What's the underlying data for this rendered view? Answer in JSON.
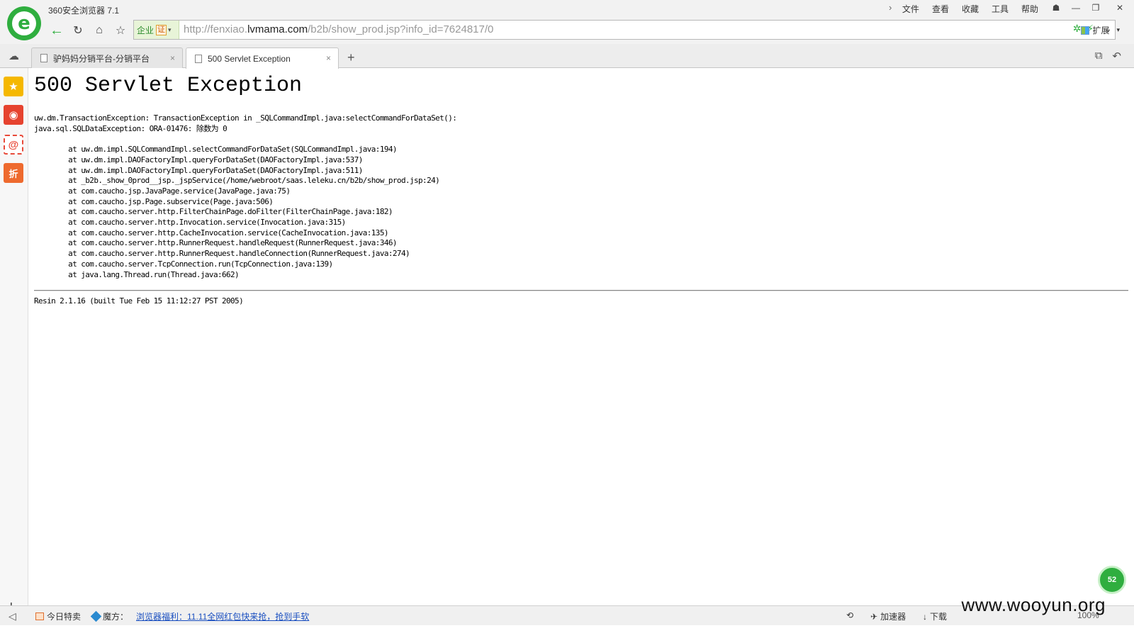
{
  "window": {
    "app_title": "360安全浏览器 7.1",
    "menu": [
      "文件",
      "查看",
      "收藏",
      "工具",
      "帮助"
    ],
    "menu_arrow": "›",
    "controls": [
      "☗",
      "—",
      "❐",
      "✕"
    ]
  },
  "navbar": {
    "back": "←",
    "reload": "↻",
    "home": "⌂",
    "favorite": "☆",
    "cert_label": "企业",
    "cert_badge": "证",
    "cert_arrow": "▾",
    "url_prefix": "http://fenxiao.",
    "url_host": "lvmama.com",
    "url_path": "/b2b/show_prod.jsp?info_id=7624817/0",
    "addr_icon_1": "✲",
    "addr_icon_2": "⚡",
    "dropdown": "⌄",
    "extend_label": "扩展",
    "extend_arrow": "▾"
  },
  "tabs": [
    {
      "title": "驴妈妈分销平台-分销平台",
      "active": false
    },
    {
      "title": "500 Servlet Exception",
      "active": true
    }
  ],
  "tab_close": "×",
  "new_tab": "+",
  "cloud_glyph": "☁",
  "tabbar_right": [
    "⧉",
    "↶"
  ],
  "sidebar": {
    "icons": [
      {
        "name": "favorites-star-icon",
        "glyph": "★",
        "bg": "#f5b800"
      },
      {
        "name": "weibo-icon",
        "glyph": "◉",
        "bg": "#e6432f"
      },
      {
        "name": "mail-icon",
        "glyph": "@",
        "bg": "#e84a3a"
      },
      {
        "name": "discount-icon",
        "glyph": "折",
        "bg": "#ee6a2e"
      }
    ],
    "plus": "+"
  },
  "page": {
    "heading": "500 Servlet Exception",
    "trace": "uw.dm.TransactionException: TransactionException in _SQLCommandImpl.java:selectCommandForDataSet():\njava.sql.SQLDataException: ORA-01476: 除数为 0\n\n        at uw.dm.impl.SQLCommandImpl.selectCommandForDataSet(SQLCommandImpl.java:194)\n        at uw.dm.impl.DAOFactoryImpl.queryForDataSet(DAOFactoryImpl.java:537)\n        at uw.dm.impl.DAOFactoryImpl.queryForDataSet(DAOFactoryImpl.java:511)\n        at _b2b._show_0prod__jsp._jspService(/home/webroot/saas.leleku.cn/b2b/show_prod.jsp:24)\n        at com.caucho.jsp.JavaPage.service(JavaPage.java:75)\n        at com.caucho.jsp.Page.subservice(Page.java:506)\n        at com.caucho.server.http.FilterChainPage.doFilter(FilterChainPage.java:182)\n        at com.caucho.server.http.Invocation.service(Invocation.java:315)\n        at com.caucho.server.http.CacheInvocation.service(CacheInvocation.java:135)\n        at com.caucho.server.http.RunnerRequest.handleRequest(RunnerRequest.java:346)\n        at com.caucho.server.http.RunnerRequest.handleConnection(RunnerRequest.java:274)\n        at com.caucho.server.TcpConnection.run(TcpConnection.java:139)\n        at java.lang.Thread.run(Thread.java:662)",
    "footer": "Resin 2.1.16 (built Tue Feb 15 11:12:27 PST 2005)"
  },
  "statusbar": {
    "collapse": "◁",
    "today_special": "今日特卖",
    "mofang_label": "魔方：",
    "promo_link": "浏览器福利：11.11全网红包快来抢，抢到手软",
    "accelerator": "加速器",
    "download": "下载",
    "zoom": "100%",
    "speed_glyph": "⟲",
    "accel_glyph": "✈",
    "download_glyph": "↓"
  },
  "watermark": "www.wooyun.org",
  "float_ball": "52"
}
